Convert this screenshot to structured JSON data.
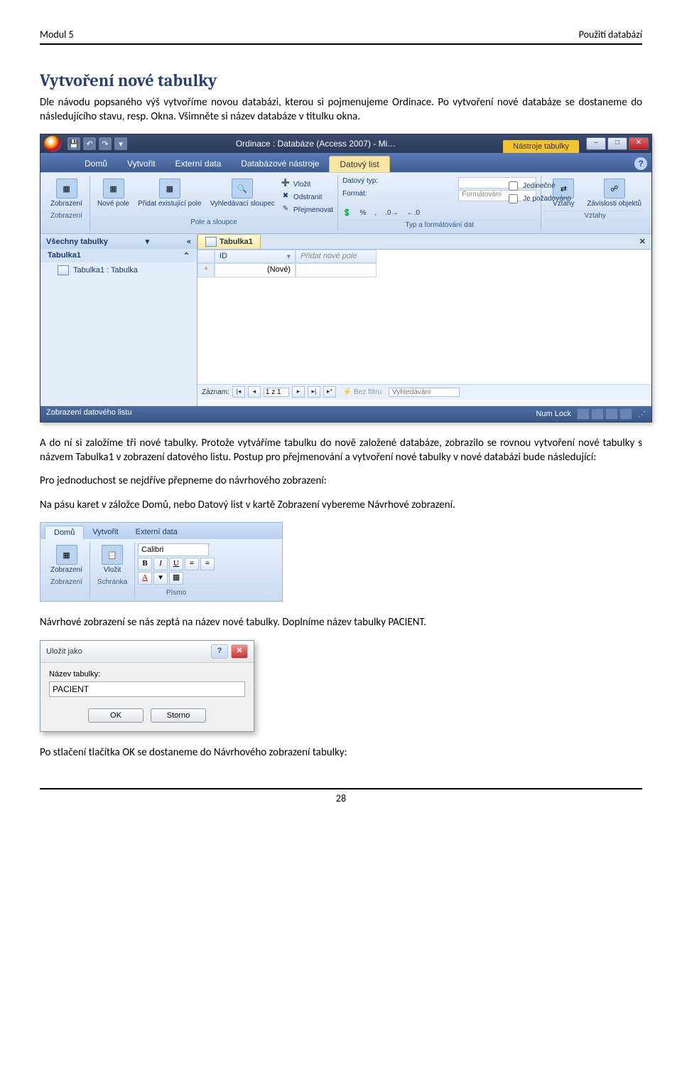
{
  "header": {
    "left": "Modul 5",
    "right": "Použití databází"
  },
  "title": "Vytvoření nové tabulky",
  "para1": "Dle návodu popsaného výš vytvoříme novou databázi, kterou si pojmenujeme Ordinace. Po vytvoření nové databáze se dostaneme do následujícího stavu, resp. Okna. Všimněte si název databáze v titulku okna.",
  "para2": "A do ní si založíme tři nové tabulky. Protože vytváříme tabulku do nově založené databáze, zobrazilo se rovnou vytvoření nové tabulky s názvem Tabulka1 v zobrazení datového listu. Postup pro přejmenování a vytvoření nové tabulky v nové databázi bude následující:",
  "para3": "Pro jednoduchost se nejdříve přepneme do návrhového zobrazení:",
  "para4": "Na pásu karet v záložce Domů, nebo Datový list v kartě Zobrazení vybereme Návrhové zobrazení.",
  "para5": "Návrhové zobrazení se nás zeptá na název nové tabulky. Doplníme název tabulky PACIENT.",
  "para6": "Po stlačení tlačítka OK se dostaneme do Návrhového zobrazení tabulky:",
  "page_no": "28",
  "win": {
    "title": "Ordinace : Databáze (Access 2007) - Mi…",
    "contextual_tab": "Nástroje tabulky",
    "tabs": [
      "Domů",
      "Vytvořit",
      "Externí data",
      "Databázové nástroje",
      "Datový list"
    ],
    "ribbon": {
      "g1": {
        "btn": "Zobrazení",
        "label": "Zobrazení"
      },
      "g2": {
        "btns": [
          "Nové pole",
          "Přidat existující pole",
          "Vyhledávací sloupec"
        ],
        "small": [
          "Vložit",
          "Odstranit",
          "Přejmenovat"
        ],
        "label": "Pole a sloupce"
      },
      "g3": {
        "rows": [
          [
            "Datový typ:",
            ""
          ],
          [
            "Formát:",
            "Formátování"
          ]
        ],
        "checks": [
          "Jedinečné",
          "Je požadováno"
        ],
        "label": "Typ a formátování dat"
      },
      "g4": {
        "btns": [
          "Vztahy",
          "Závislosti objektů"
        ],
        "label": "Vztahy"
      }
    },
    "nav": {
      "header": "Všechny tabulky",
      "group": "Tabulka1",
      "item": "Tabulka1 : Tabulka"
    },
    "doc": {
      "tab": "Tabulka1",
      "cols": [
        "ID",
        "Přidat nové pole"
      ],
      "first_val": "(Nové)",
      "rec_label": "Záznam:",
      "rec_pos": "1 z 1",
      "filter": "Bez filtru",
      "search": "Vyhledávání"
    },
    "status": {
      "left": "Zobrazení datového listu",
      "right": "Num Lock"
    }
  },
  "ribbon2": {
    "tabs": [
      "Domů",
      "Vytvořit",
      "Externí data"
    ],
    "g1": "Zobrazení",
    "g2": "Vložit",
    "g1_label": "Zobrazení",
    "g2_label": "Schránka",
    "font_name": "Calibri",
    "g3_label": "Písmo"
  },
  "dlg": {
    "title": "Uložit jako",
    "label": "Název tabulky:",
    "value": "PACIENT",
    "ok": "OK",
    "cancel": "Storno"
  }
}
